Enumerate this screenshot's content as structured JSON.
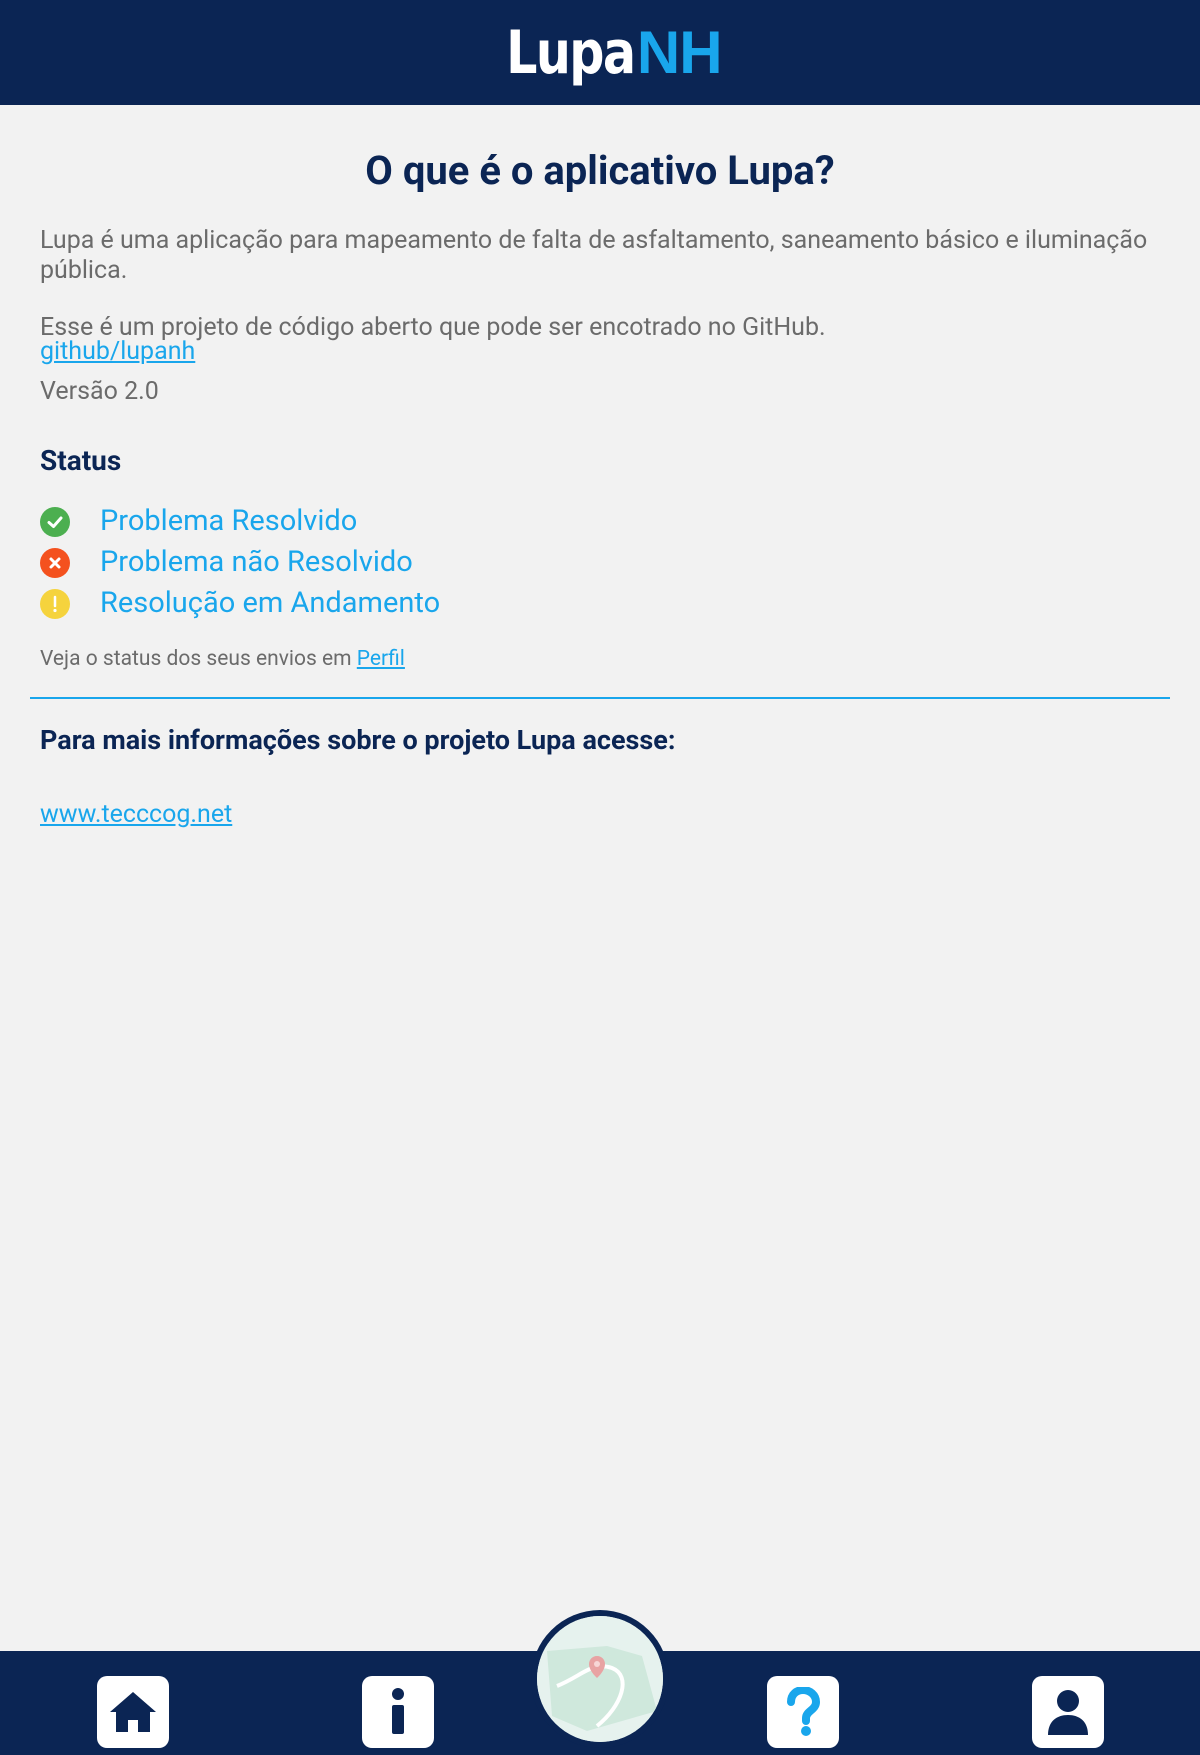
{
  "header": {
    "logo_part1": "Lupa",
    "logo_part2": "NH"
  },
  "about": {
    "title": "O que é o aplicativo Lupa?",
    "description": "Lupa é uma aplicação para mapeamento de falta de asfaltamento, saneamento básico e iluminação pública.",
    "open_source_text": "Esse é um projeto de código aberto que pode ser encotrado no GitHub.",
    "github_link": "github/lupanh",
    "version": "Versão 2.0"
  },
  "status": {
    "heading": "Status",
    "items": [
      {
        "label": "Problema Resolvido",
        "icon": "check-icon",
        "color": "#4caf50",
        "glyph": "✓"
      },
      {
        "label": "Problema não Resolvido",
        "icon": "close-icon",
        "color": "#f4511e",
        "glyph": "✕"
      },
      {
        "label": "Resolução em Andamento",
        "icon": "exclamation-icon",
        "color": "#f5d33d",
        "glyph": "!"
      }
    ],
    "hint_prefix": "Veja o status dos seus envios em ",
    "hint_link": "Perfil"
  },
  "more_info": {
    "heading": "Para mais informações sobre o projeto Lupa acesse:",
    "link": "www.tecccog.net"
  },
  "nav": {
    "items": [
      {
        "name": "home",
        "icon": "home-icon"
      },
      {
        "name": "info",
        "icon": "info-icon"
      },
      {
        "name": "map",
        "icon": "map-icon"
      },
      {
        "name": "help",
        "icon": "question-icon"
      },
      {
        "name": "profile",
        "icon": "user-icon"
      }
    ]
  },
  "colors": {
    "primary_dark": "#0b2554",
    "accent": "#19a6ec",
    "background": "#f2f2f2",
    "text_gray": "#6b6b6b"
  }
}
